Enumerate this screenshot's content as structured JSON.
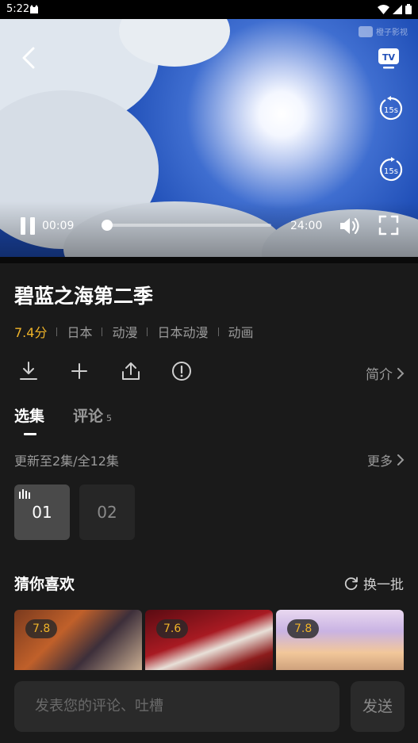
{
  "status_bar": {
    "time": "5:22",
    "icons": [
      "cat-notification-icon",
      "wifi-icon",
      "signal-icon",
      "battery-icon"
    ]
  },
  "player": {
    "watermark": "橙子影视",
    "current_time": "00:09",
    "total_time": "24:00",
    "progress_percent": 0.6,
    "replay_back_label": "15s",
    "replay_forward_label": "15s",
    "icons": [
      "back-icon",
      "tv-cast-icon",
      "rewind-15s-icon",
      "forward-15s-icon",
      "pause-icon",
      "volume-icon",
      "fullscreen-icon"
    ]
  },
  "show": {
    "title": "碧蓝之海第二季",
    "score": "7.4分",
    "tags": [
      "日本",
      "动漫",
      "日本动漫",
      "动画"
    ]
  },
  "actions": {
    "icons": [
      "download-icon",
      "add-icon",
      "share-icon",
      "report-icon"
    ],
    "intro_label": "简介"
  },
  "tabs": {
    "episodes_label": "选集",
    "comments_label": "评论",
    "comments_count": "5"
  },
  "episodes": {
    "update_text": "更新至2集/全12集",
    "more_label": "更多",
    "items": [
      {
        "label": "01",
        "selected": true
      },
      {
        "label": "02",
        "selected": false
      }
    ]
  },
  "recommend": {
    "title": "猜你喜欢",
    "refresh_label": "换一批",
    "cards": [
      {
        "rating": "7.8"
      },
      {
        "rating": "7.6"
      },
      {
        "rating": "7.8"
      }
    ]
  },
  "comment_bar": {
    "placeholder": "发表您的评论、吐槽",
    "send_label": "发送"
  },
  "colors": {
    "accent_score": "#f0b429",
    "background": "#1a1a1a",
    "muted_text": "#9a9a9a"
  }
}
